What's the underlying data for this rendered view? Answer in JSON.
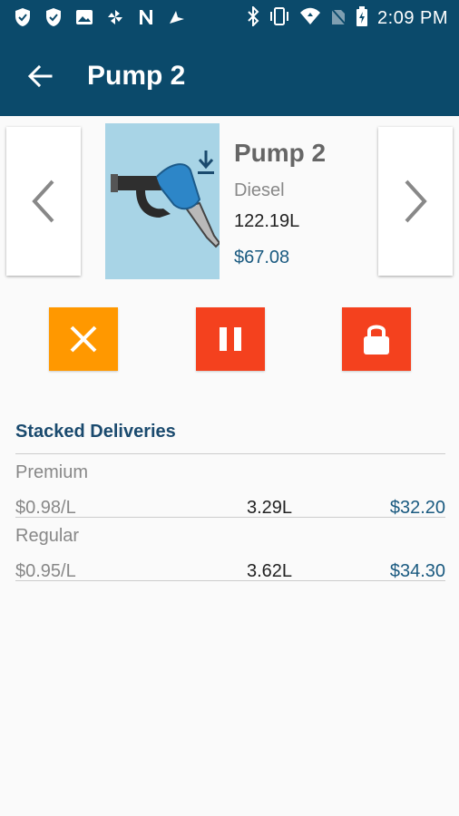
{
  "status_bar": {
    "time": "2:09 PM",
    "icons": [
      "shield-icon",
      "shield-icon",
      "image-icon",
      "pinwheel-icon",
      "n-icon",
      "arrow-icon",
      "bluetooth-icon",
      "vibrate-icon",
      "wifi-icon",
      "no-sim-icon",
      "battery-charging-icon"
    ]
  },
  "app_bar": {
    "title": "Pump 2",
    "back_icon": "back-arrow-icon"
  },
  "pump": {
    "name": "Pump 2",
    "fuel": "Diesel",
    "volume": "122.19L",
    "amount": "$67.08",
    "image_icon": "fuel-nozzle-icon",
    "badge_icon": "download-icon"
  },
  "nav": {
    "prev_icon": "chevron-left-icon",
    "next_icon": "chevron-right-icon"
  },
  "actions": [
    {
      "name": "cancel",
      "icon": "close-icon",
      "color": "#ff9800"
    },
    {
      "name": "pause",
      "icon": "pause-icon",
      "color": "#f4411e"
    },
    {
      "name": "lock",
      "icon": "lock-icon",
      "color": "#f4411e"
    }
  ],
  "stacked": {
    "title": "Stacked Deliveries",
    "rows": [
      {
        "grade": "Premium",
        "price": "$0.98/L",
        "volume": "3.29L",
        "amount": "$32.20"
      },
      {
        "grade": "Regular",
        "price": "$0.95/L",
        "volume": "3.62L",
        "amount": "$34.30"
      }
    ]
  },
  "colors": {
    "primary": "#0b4a6b",
    "accent_text": "#1a5a80",
    "orange": "#ff9800",
    "red": "#f4411e"
  }
}
